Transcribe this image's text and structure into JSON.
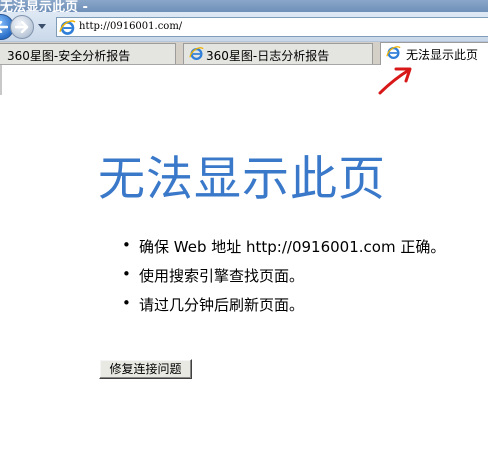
{
  "window": {
    "title": "无法显示此页 -"
  },
  "address_bar": {
    "url": "http://0916001.com/"
  },
  "tabs": [
    {
      "label": "360星图-安全分析报告",
      "active": false,
      "has_icon": false
    },
    {
      "label": "360星图-日志分析报告",
      "active": false,
      "has_icon": true
    },
    {
      "label": "无法显示此页",
      "active": true,
      "has_icon": true
    }
  ],
  "page": {
    "heading": "无法显示此页",
    "suggestions": [
      "确保 Web 地址 http://0916001.com 正确。",
      "使用搜索引擎查找页面。",
      "请过几分钟后刷新页面。"
    ],
    "repair_button": "修复连接问题"
  },
  "colors": {
    "heading": "#3a78c9",
    "annotation_arrow": "#d81818",
    "title_bar": "#7f9dc2"
  },
  "icons": [
    "back-arrow-icon",
    "forward-arrow-icon",
    "chevron-down-icon",
    "ie-icon",
    "red-arrow-annotation"
  ]
}
